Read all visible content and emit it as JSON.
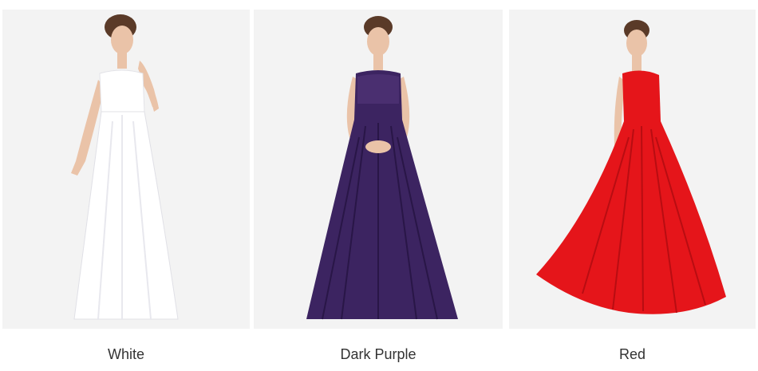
{
  "products": [
    {
      "label": "White",
      "dress_color": "#ffffff",
      "shade_color": "#e6e6ea"
    },
    {
      "label": "Dark Purple",
      "dress_color": "#3c2461",
      "shade_color": "#291647"
    },
    {
      "label": "Red",
      "dress_color": "#e5151a",
      "shade_color": "#b80d12"
    }
  ],
  "colors": {
    "card_background": "#f3f3f3",
    "caption_text": "#333333",
    "skin": "#eac3a8",
    "hair": "#5a3a28"
  }
}
